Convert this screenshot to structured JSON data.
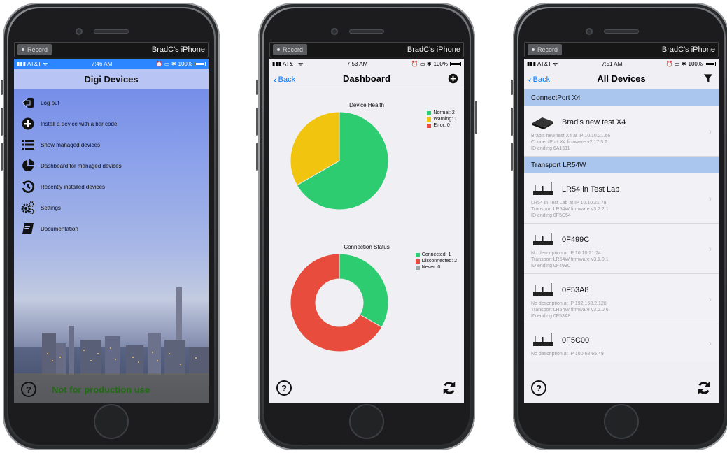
{
  "phones": [
    {
      "record_label": "Record",
      "device_name": "BradC's iPhone",
      "status": {
        "carrier": "AT&T",
        "time": "7:46 AM",
        "battery": "100%"
      },
      "title": "Digi Devices",
      "menu": [
        {
          "label": "Log out",
          "icon": "logout-icon"
        },
        {
          "label": "Install a device with a bar code",
          "icon": "plus-circle-icon"
        },
        {
          "label": "Show managed devices",
          "icon": "list-icon"
        },
        {
          "label": "Dashboard for managed devices",
          "icon": "pie-icon"
        },
        {
          "label": "Recently installed devices",
          "icon": "history-icon"
        },
        {
          "label": "Settings",
          "icon": "gears-icon"
        },
        {
          "label": "Documentation",
          "icon": "book-icon"
        }
      ],
      "help": "?",
      "footer_text": "Not for production use"
    },
    {
      "record_label": "Record",
      "device_name": "BradC's iPhone",
      "status": {
        "carrier": "AT&T",
        "time": "7:53 AM",
        "battery": "100%"
      },
      "back": "Back",
      "title": "Dashboard",
      "help": "?"
    },
    {
      "record_label": "Record",
      "device_name": "BradC's iPhone",
      "status": {
        "carrier": "AT&T",
        "time": "7:51 AM",
        "battery": "100%"
      },
      "back": "Back",
      "title": "All Devices",
      "help": "?",
      "sections": [
        {
          "header": "ConnectPort X4",
          "devices": [
            {
              "name": "Brad's new test X4",
              "lines": [
                "Brad's new test X4 at IP 10.10.21.66",
                "ConnectPort X4 firmware v2.17.3.2",
                "ID ending 6A1511"
              ]
            }
          ]
        },
        {
          "header": "Transport LR54W",
          "devices": [
            {
              "name": "LR54 in Test Lab",
              "lines": [
                "LR54 in Test Lab at IP 10.10.21.78",
                "Transport LR54W firmware v3.2.2.1",
                "ID ending 0F5C54"
              ]
            },
            {
              "name": "0F499C",
              "lines": [
                "No description at IP 10.10.21.74",
                "Transport LR54W firmware v3.1.0.1",
                "ID ending 0F499C"
              ]
            },
            {
              "name": "0F53A8",
              "lines": [
                "No description at IP 192.168.2.128",
                "Transport LR54W firmware v3.2.0.6",
                "ID ending 0F53A8"
              ]
            },
            {
              "name": "0F5C00",
              "lines": [
                "No description at IP 100.68.65.49"
              ]
            }
          ]
        }
      ]
    }
  ],
  "chart_data": [
    {
      "type": "pie",
      "title": "Device Health",
      "categories": [
        "Normal",
        "Warning",
        "Error"
      ],
      "values": [
        2,
        1,
        0
      ],
      "legend": [
        "Normal: 2",
        "Warning: 1",
        "Error: 0"
      ],
      "colors": [
        "#2ecc71",
        "#f1c40f",
        "#e74c3c"
      ],
      "legend_position": "top-right"
    },
    {
      "type": "pie",
      "variant": "donut",
      "title": "Connection Status",
      "categories": [
        "Connected",
        "Disconnected",
        "Never"
      ],
      "values": [
        1,
        2,
        0
      ],
      "legend": [
        "Connected: 1",
        "Disconnected: 2",
        "Never: 0"
      ],
      "colors": [
        "#2ecc71",
        "#e74c3c",
        "#95a5a6"
      ],
      "legend_position": "top-right"
    }
  ]
}
